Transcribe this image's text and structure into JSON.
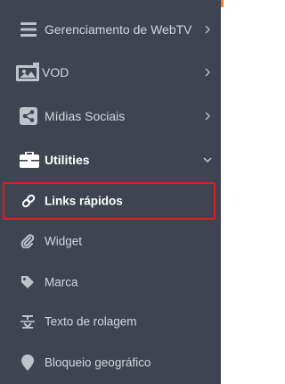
{
  "sidebar": {
    "items": [
      {
        "label": "Gerenciamento de WebTV",
        "icon": "menu-bars-icon"
      },
      {
        "label": "VOD",
        "icon": "media-library-icon"
      },
      {
        "label": "Mídias Sociais",
        "icon": "share-icon"
      },
      {
        "label": "Utilities",
        "icon": "toolbox-icon",
        "expanded": true
      }
    ],
    "sub_items": [
      {
        "label": "Links rápidos",
        "icon": "link-icon",
        "selected": true
      },
      {
        "label": "Widget",
        "icon": "paperclip-icon"
      },
      {
        "label": "Marca",
        "icon": "tag-icon"
      },
      {
        "label": "Texto de rolagem",
        "icon": "text-scroll-icon"
      },
      {
        "label": "Bloqueio geográfico",
        "icon": "map-pin-icon"
      }
    ]
  },
  "colors": {
    "sidebar_bg": "#3e4450",
    "text": "#d3d6db",
    "active_text": "#ffffff",
    "highlight_border": "#e01e1e",
    "accent": "#f07e24"
  }
}
